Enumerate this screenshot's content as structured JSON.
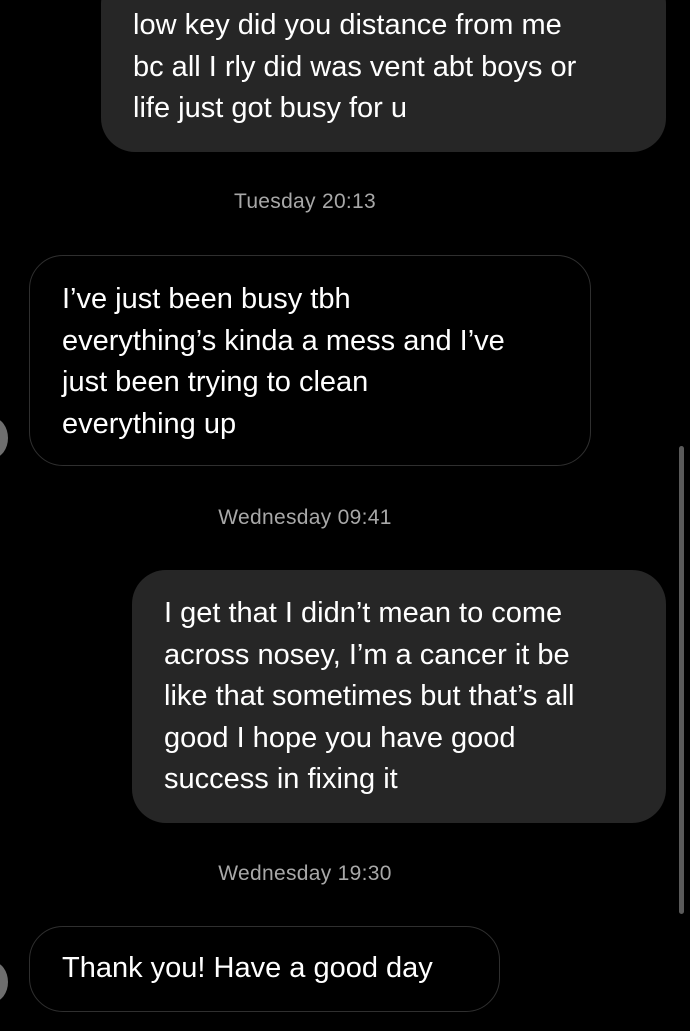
{
  "conversation": {
    "messages": [
      {
        "sender": "me",
        "lines": [
          "low key did you distance from me",
          "bc all I rly did was vent abt boys or",
          "life just got busy for u"
        ]
      },
      {
        "sender": "them",
        "lines": [
          "I’ve just been busy tbh",
          "everything’s kinda a mess and I’ve",
          "just been trying to clean",
          "everything up"
        ]
      },
      {
        "sender": "me",
        "lines": [
          "I get that I didn’t mean to come",
          "across nosey, I’m a cancer it be",
          "like that sometimes but that’s all",
          "good I hope you have good",
          "success in fixing it"
        ]
      },
      {
        "sender": "them",
        "lines": [
          "Thank you! Have a good day"
        ]
      }
    ],
    "timestamps": [
      "Tuesday 20:13",
      "Wednesday 09:41",
      "Wednesday 19:30"
    ]
  },
  "colors": {
    "background": "#000000",
    "sent_bubble": "#262626",
    "received_border": "#2f2f2f",
    "message_text": "#ffffff",
    "timestamp_text": "#a8a8a8"
  }
}
